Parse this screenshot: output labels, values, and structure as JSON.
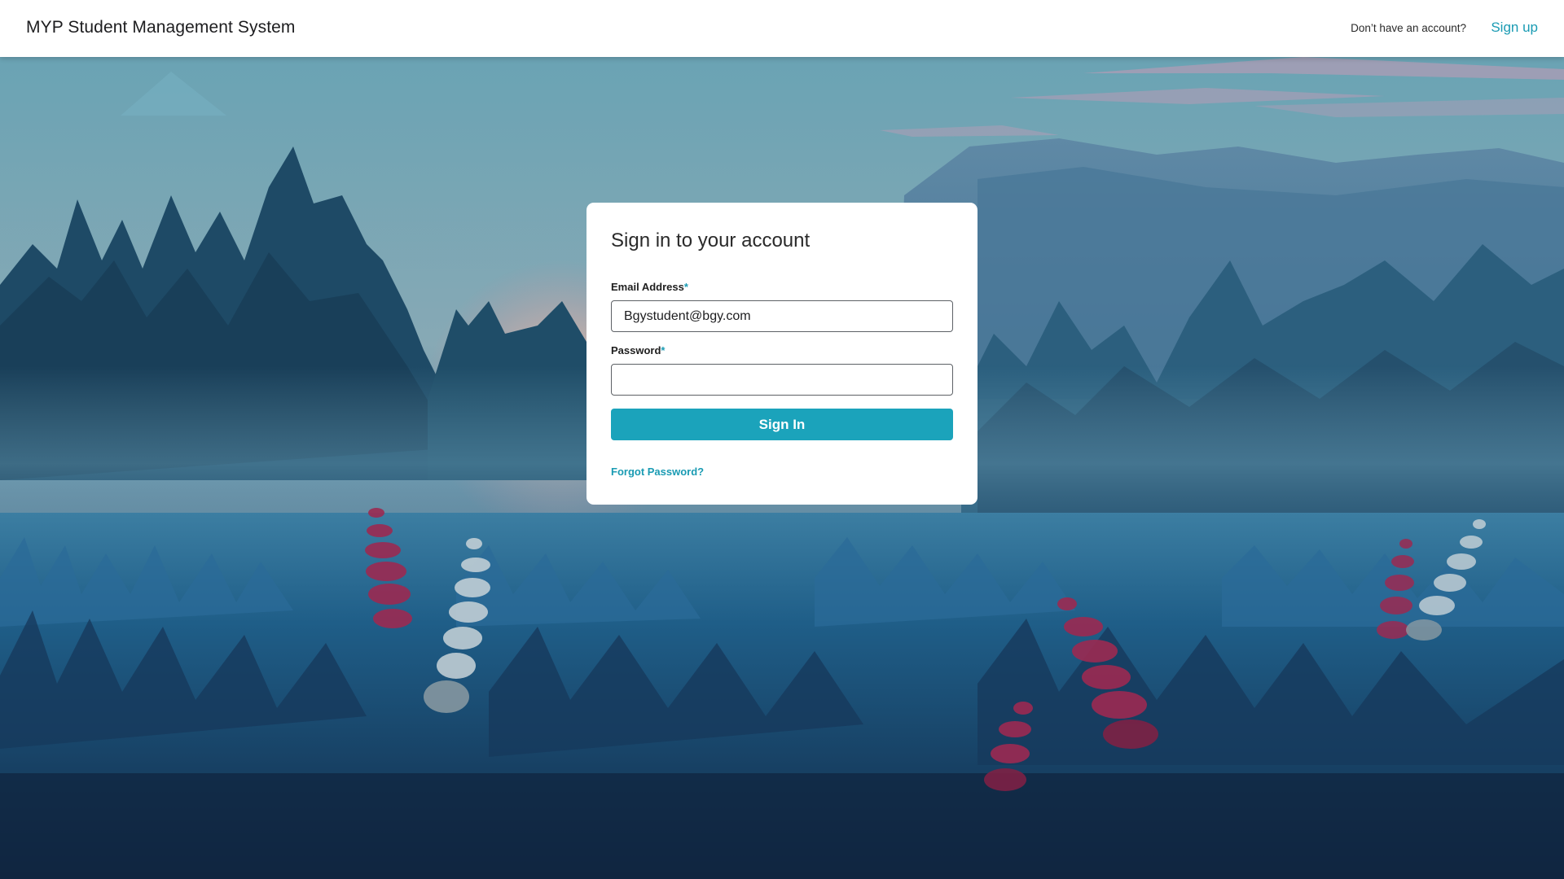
{
  "header": {
    "app_title": "MYP Student Management System",
    "signup_prompt": "Don’t have an account?",
    "signup_link": "Sign up"
  },
  "login": {
    "title": "Sign in to your account",
    "email_label": "Email Address",
    "email_value": "Bgystudent@bgy.com",
    "password_label": "Password",
    "password_value": "",
    "required_marker": "*",
    "signin_button": "Sign In",
    "forgot_link": "Forgot Password?"
  },
  "colors": {
    "accent": "#1ba3bb",
    "link": "#1a9bb3",
    "header_bg": "#ffffff"
  }
}
